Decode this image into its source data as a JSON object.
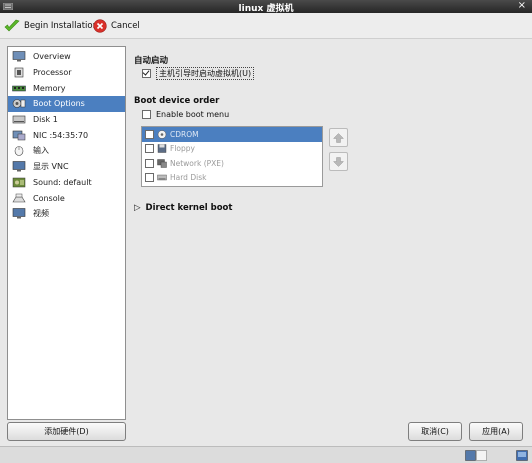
{
  "window": {
    "title": "linux 虚拟机",
    "close_glyph": "×"
  },
  "toolbar": {
    "begin_label": "Begin Installation",
    "cancel_label": "Cancel"
  },
  "sidebar": {
    "items": [
      {
        "label": "Overview",
        "icon": "monitor-icon",
        "selected": false
      },
      {
        "label": "Processor",
        "icon": "processor-icon",
        "selected": false
      },
      {
        "label": "Memory",
        "icon": "memory-icon",
        "selected": false
      },
      {
        "label": "Boot Options",
        "icon": "boot-options-icon",
        "selected": true
      },
      {
        "label": "Disk 1",
        "icon": "disk-icon",
        "selected": false
      },
      {
        "label": "NIC :54:35:70",
        "icon": "nic-icon",
        "selected": false
      },
      {
        "label": "输入",
        "icon": "input-icon",
        "selected": false
      },
      {
        "label": "显示 VNC",
        "icon": "display-icon",
        "selected": false
      },
      {
        "label": "Sound: default",
        "icon": "sound-icon",
        "selected": false
      },
      {
        "label": "Console",
        "icon": "console-icon",
        "selected": false
      },
      {
        "label": "视频",
        "icon": "video-icon",
        "selected": false
      }
    ],
    "add_hardware_label": "添加硬件(D)"
  },
  "main": {
    "autostart_heading": "自动启动",
    "autostart_checkbox_label": "主机引导时启动虚拟机(U)",
    "autostart_checked": true,
    "boot_order_heading": "Boot device order",
    "enable_boot_menu_label": "Enable boot menu",
    "enable_boot_menu_checked": false,
    "boot_devices": [
      {
        "label": "CDROM",
        "icon": "cdrom-icon",
        "checked": false,
        "selected": true
      },
      {
        "label": "Floppy",
        "icon": "floppy-icon",
        "checked": false,
        "selected": false
      },
      {
        "label": "Network (PXE)",
        "icon": "network-icon",
        "checked": false,
        "selected": false
      },
      {
        "label": "Hard Disk",
        "icon": "hard-disk-icon",
        "checked": false,
        "selected": false
      }
    ],
    "direct_kernel_boot_label": "Direct kernel boot",
    "expander_glyph": "▷"
  },
  "footer": {
    "cancel_label": "取消(C)",
    "apply_label": "应用(A)"
  },
  "colors": {
    "selection": "#4b7fc0",
    "titlebar": "#2e2e2e",
    "begin_icon": "#5bb82a",
    "cancel_icon": "#d9302a"
  }
}
